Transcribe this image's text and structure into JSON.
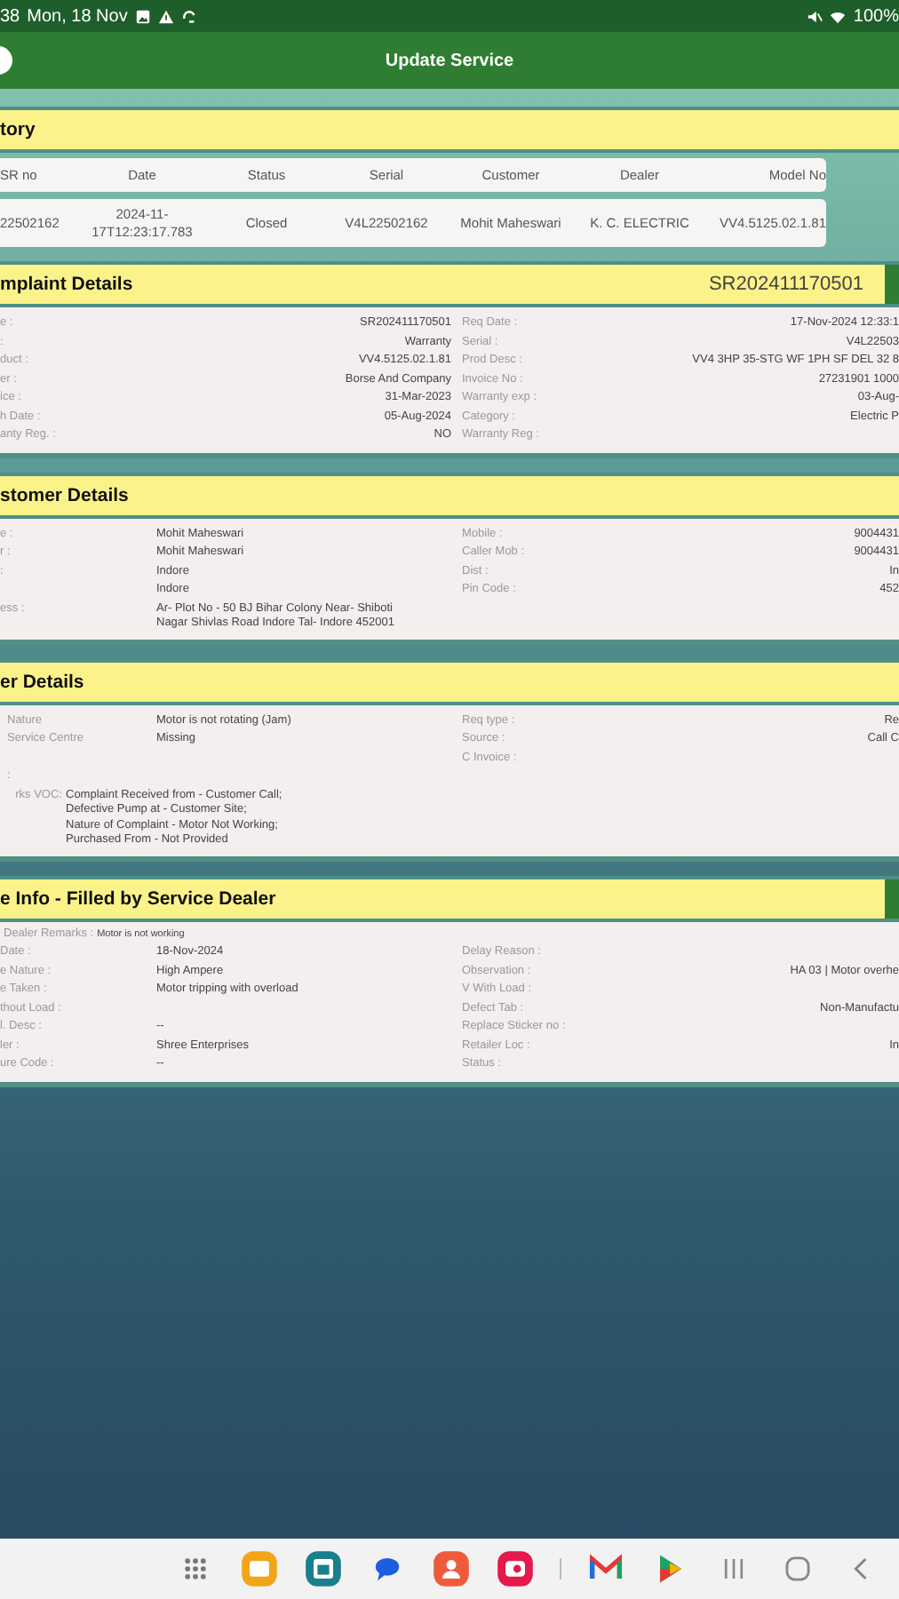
{
  "status_bar": {
    "time": "38",
    "date": "Mon, 18 Nov",
    "battery": "100%"
  },
  "app_bar": {
    "title": "Update Service"
  },
  "history": {
    "title": "tory",
    "columns": [
      "SR no",
      "Date",
      "Status",
      "Serial",
      "Customer",
      "Dealer",
      "Model No"
    ],
    "rows": [
      [
        "22502162",
        "2024-11-17T12:23:17.783",
        "Closed",
        "V4L22502162",
        "Mohit Maheswari",
        "K. C. ELECTRIC",
        "VV4.5125.02.1.81"
      ]
    ]
  },
  "complaint_details": {
    "title": "mplaint Details",
    "sr_number": "SR202411170501",
    "left": [
      {
        "label": "e :",
        "value": "SR202411170501"
      },
      {
        "label": ":",
        "value": "Warranty"
      },
      {
        "label": "duct :",
        "value": "VV4.5125.02.1.81"
      },
      {
        "label": "er :",
        "value": "Borse And Company"
      },
      {
        "label": "ice :",
        "value": "31-Mar-2023"
      },
      {
        "label": "h Date :",
        "value": "05-Aug-2024"
      },
      {
        "label": "anty Reg. :",
        "value": "NO"
      }
    ],
    "right": [
      {
        "label": "Req Date :",
        "value": "17-Nov-2024 12:33:1"
      },
      {
        "label": "Serial :",
        "value": "V4L22503"
      },
      {
        "label": "Prod Desc :",
        "value": "VV4 3HP 35-STG WF 1PH SF DEL 32 8"
      },
      {
        "label": "Invoice No :",
        "value": "27231901 1000"
      },
      {
        "label": "Warranty exp :",
        "value": "03-Aug-"
      },
      {
        "label": "Category :",
        "value": "Electric P"
      },
      {
        "label": "Warranty Reg :"
      }
    ]
  },
  "customer_details": {
    "title": "stomer Details",
    "left": [
      {
        "label": "e :",
        "value": "Mohit Maheswari"
      },
      {
        "label": "r :",
        "value": "Mohit Maheswari"
      },
      {
        "label": ":",
        "value": "Indore"
      },
      {
        "value": "Indore"
      },
      {
        "label": "ess :",
        "value": "Ar- Plot No - 50 BJ Bihar Colony Near- Shiboti Nagar Shivlas Road Indore Tal- Indore 452001"
      }
    ],
    "right": [
      {
        "label": "Mobile :",
        "value": "9004431"
      },
      {
        "label": "Caller Mob :",
        "value": "9004431"
      },
      {
        "label": "Dist :",
        "value": "In"
      },
      {
        "label": "Pin Code :",
        "value": "452"
      }
    ]
  },
  "other_details": {
    "title": "er Details",
    "left": [
      {
        "label": "Nature",
        "value": "Motor is not rotating (Jam)"
      },
      {
        "label": "Service Centre",
        "value": "Missing"
      },
      {
        "label": ":"
      }
    ],
    "right": [
      {
        "label": "Req type :",
        "value": "Re"
      },
      {
        "label": "Source :",
        "value": "Call C"
      },
      {
        "label": "C Invoice :"
      }
    ],
    "remark": {
      "label": "rks VOC:",
      "value": "Complaint Received from - Customer Call;\nDefective Pump at - Customer Site;\nNature of Complaint - Motor Not Working;\nPurchased From - Not Provided"
    }
  },
  "service_info": {
    "title": "e Info - Filled by Service Dealer",
    "remark": {
      "label": "Dealer Remarks :",
      "value": "Motor is not working"
    },
    "left": [
      {
        "label": "Date :",
        "value": "18-Nov-2024"
      },
      {
        "label": "e Nature :",
        "value": "High Ampere"
      },
      {
        "label": "e Taken :",
        "value": "Motor tripping with overload"
      },
      {
        "label": "thout Load :"
      },
      {
        "label": "l. Desc :",
        "value": "--"
      },
      {
        "label": "ler :",
        "value": "Shree Enterprises"
      },
      {
        "label": "ure Code :",
        "value": "--"
      }
    ],
    "right": [
      {
        "label": "Delay Reason :"
      },
      {
        "label": "Observation :",
        "value": "HA 03 | Motor overhe"
      },
      {
        "label": "V With Load :"
      },
      {
        "label": "Defect Tab :",
        "value": "Non-Manufactu"
      },
      {
        "label": "Replace Sticker no :"
      },
      {
        "label": "Retailer Loc :",
        "value": "In"
      },
      {
        "label": "Status :"
      }
    ]
  }
}
